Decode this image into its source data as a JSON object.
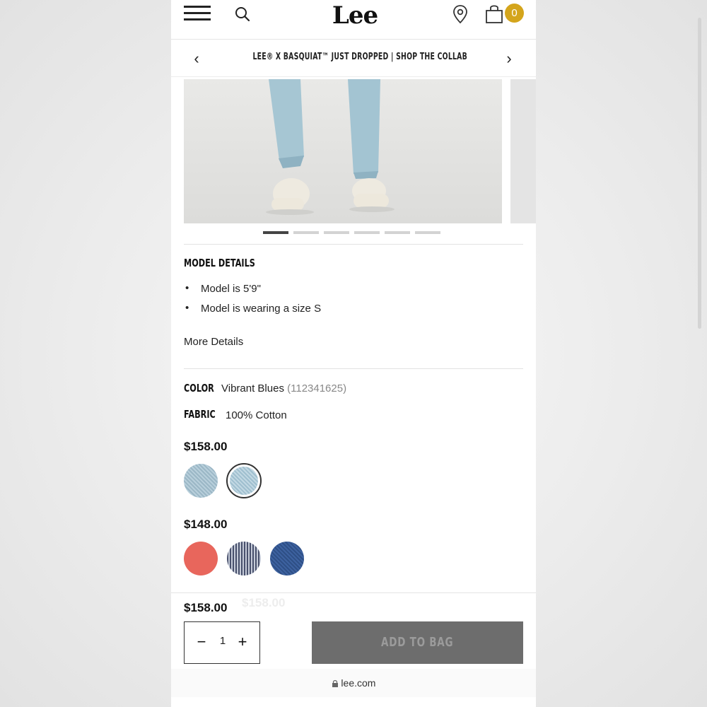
{
  "header": {
    "logo": "Lee",
    "bag_count": "0"
  },
  "promo": {
    "text": "LEE® X BASQUIAT™ JUST DROPPED | SHOP THE COLLAB"
  },
  "carousel": {
    "slide_count": 6,
    "active_index": 0
  },
  "model_details": {
    "heading": "MODEL DETAILS",
    "items": [
      "Model is 5'9\"",
      "Model is wearing a size S"
    ],
    "more_link": "More Details"
  },
  "product": {
    "color_label": "COLOR",
    "color_value": "Vibrant Blues",
    "color_code": "(112341625)",
    "fabric_label": "FABRIC",
    "fabric_value": "100% Cotton",
    "price_group_1": "$158.00",
    "price_group_2": "$148.00",
    "swatches_group_1": [
      "light-wash",
      "light-wash-selected"
    ],
    "swatches_group_2": [
      "coral-red",
      "hickory-stripe",
      "dark-indigo"
    ]
  },
  "purchase": {
    "price": "$158.00",
    "ghost_price": "$158.00",
    "quantity": "1",
    "minus": "−",
    "plus": "+",
    "add_to_bag": "ADD TO BAG"
  },
  "browser": {
    "url": "lee.com"
  },
  "colors": {
    "badge": "#d4a51c",
    "add_button": "#6d6d6d"
  }
}
